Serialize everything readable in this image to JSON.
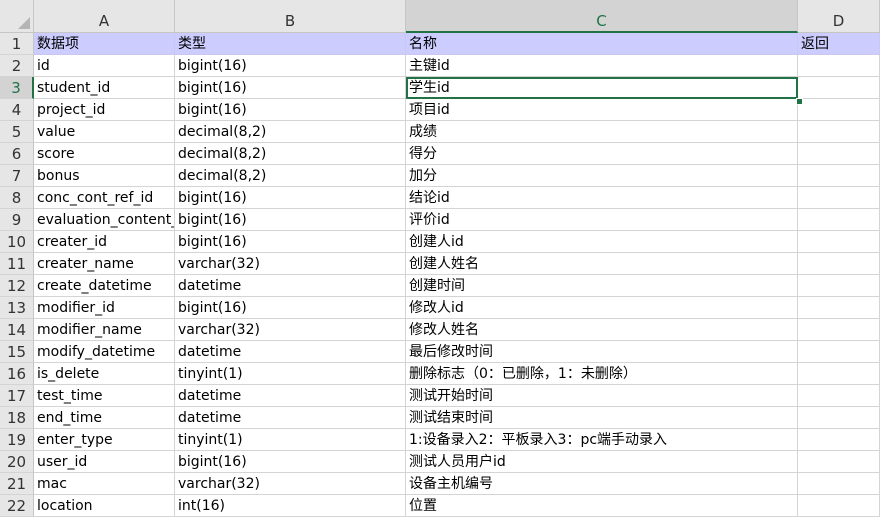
{
  "columns": [
    "A",
    "B",
    "C",
    "D"
  ],
  "rows": [
    {
      "n": "1",
      "cells": [
        "数据项",
        "类型",
        "名称",
        "返回"
      ]
    },
    {
      "n": "2",
      "cells": [
        "id",
        "bigint(16)",
        "主键id",
        ""
      ]
    },
    {
      "n": "3",
      "cells": [
        "student_id",
        "bigint(16)",
        "学生id",
        ""
      ]
    },
    {
      "n": "4",
      "cells": [
        "project_id",
        "bigint(16)",
        "项目id",
        ""
      ]
    },
    {
      "n": "5",
      "cells": [
        "value",
        "decimal(8,2)",
        "成绩",
        ""
      ]
    },
    {
      "n": "6",
      "cells": [
        "score",
        "decimal(8,2)",
        "得分",
        ""
      ]
    },
    {
      "n": "7",
      "cells": [
        "bonus",
        "decimal(8,2)",
        "加分",
        ""
      ]
    },
    {
      "n": "8",
      "cells": [
        "conc_cont_ref_id",
        "bigint(16)",
        "结论id",
        ""
      ]
    },
    {
      "n": "9",
      "cells": [
        "evaluation_content_",
        "bigint(16)",
        "评价id",
        ""
      ]
    },
    {
      "n": "10",
      "cells": [
        "creater_id",
        "bigint(16)",
        "创建人id",
        ""
      ]
    },
    {
      "n": "11",
      "cells": [
        "creater_name",
        "varchar(32)",
        "创建人姓名",
        ""
      ]
    },
    {
      "n": "12",
      "cells": [
        "create_datetime",
        "datetime",
        "创建时间",
        ""
      ]
    },
    {
      "n": "13",
      "cells": [
        "modifier_id",
        "bigint(16)",
        "修改人id",
        ""
      ]
    },
    {
      "n": "14",
      "cells": [
        "modifier_name",
        "varchar(32)",
        "修改人姓名",
        ""
      ]
    },
    {
      "n": "15",
      "cells": [
        "modify_datetime",
        "datetime",
        "最后修改时间",
        ""
      ]
    },
    {
      "n": "16",
      "cells": [
        "is_delete",
        "tinyint(1)",
        "删除标志（0：已删除，1：未删除）",
        ""
      ]
    },
    {
      "n": "17",
      "cells": [
        "test_time",
        "datetime",
        "测试开始时间",
        ""
      ]
    },
    {
      "n": "18",
      "cells": [
        "end_time",
        "datetime",
        "测试结束时间",
        ""
      ]
    },
    {
      "n": "19",
      "cells": [
        "enter_type",
        "tinyint(1)",
        "1:设备录入2：平板录入3：pc端手动录入",
        ""
      ]
    },
    {
      "n": "20",
      "cells": [
        "user_id",
        "bigint(16)",
        "测试人员用户id",
        ""
      ]
    },
    {
      "n": "21",
      "cells": [
        "mac",
        "varchar(32)",
        "设备主机编号",
        ""
      ]
    },
    {
      "n": "22",
      "cells": [
        "location",
        "int(16)",
        "位置",
        ""
      ]
    }
  ],
  "selection": {
    "row": "3",
    "column": "C"
  },
  "colors": {
    "header_fill": "#ccccff",
    "selection": "#217346",
    "grid": "#d4d4d4"
  }
}
